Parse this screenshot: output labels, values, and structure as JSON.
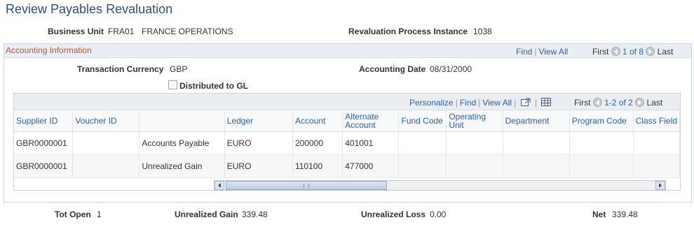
{
  "page": {
    "title": "Review Payables Revaluation"
  },
  "header": {
    "business_unit_label": "Business Unit",
    "business_unit_code": "FRA01",
    "business_unit_name": "FRANCE OPERATIONS",
    "process_instance_label": "Revaluation Process Instance",
    "process_instance_value": "1038"
  },
  "section": {
    "title": "Accounting Information",
    "nav": {
      "find": "Find",
      "view_all": "View All",
      "first": "First",
      "range": "1 of 8",
      "last": "Last"
    },
    "transaction_currency_label": "Transaction Currency",
    "transaction_currency_value": "GBP",
    "accounting_date_label": "Accounting Date",
    "accounting_date_value": "08/31/2000",
    "distributed_label": "Distributed to GL",
    "distributed_checked": false
  },
  "grid": {
    "nav": {
      "personalize": "Personalize",
      "find": "Find",
      "view_all": "View All",
      "first": "First",
      "range": "1-2 of 2",
      "last": "Last"
    },
    "columns": [
      "Supplier ID",
      "Voucher ID",
      "",
      "Ledger",
      "Account",
      "Alternate Account",
      "Fund Code",
      "Operating Unit",
      "Department",
      "Program Code",
      "Class Field"
    ],
    "rows": [
      [
        "GBR0000001",
        "",
        "Accounts Payable",
        "EURO",
        "200000",
        "401001",
        "",
        "",
        "",
        "",
        ""
      ],
      [
        "GBR0000001",
        "",
        "Unrealized Gain",
        "EURO",
        "110100",
        "477000",
        "",
        "",
        "",
        "",
        ""
      ]
    ]
  },
  "totals": {
    "tot_open_label": "Tot Open",
    "tot_open_value": "1",
    "unrealized_gain_label": "Unrealized Gain",
    "unrealized_gain_value": "339.48",
    "unrealized_loss_label": "Unrealized Loss",
    "unrealized_loss_value": "0.00",
    "net_label": "Net",
    "net_value": "339.48"
  }
}
